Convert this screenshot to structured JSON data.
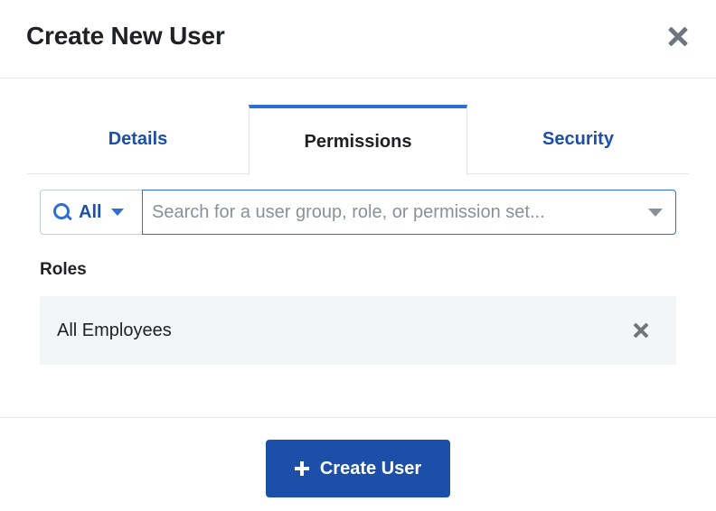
{
  "dialog": {
    "title": "Create New User"
  },
  "tabs": [
    {
      "label": "Details",
      "active": false
    },
    {
      "label": "Permissions",
      "active": true
    },
    {
      "label": "Security",
      "active": false
    }
  ],
  "search": {
    "filter_label": "All",
    "placeholder": "Search for a user group, role, or permission set...",
    "value": ""
  },
  "roles": {
    "heading": "Roles",
    "items": [
      {
        "name": "All Employees"
      }
    ]
  },
  "footer": {
    "create_label": "Create User"
  },
  "icons": {
    "close": "close-icon",
    "search": "search-icon",
    "filter_caret": "chevron-down-icon",
    "search_caret": "chevron-down-icon",
    "remove": "remove-icon",
    "plus": "plus-icon"
  },
  "colors": {
    "accent": "#2d6fd6",
    "primary_button": "#1c4fa8",
    "tab_link": "#1c4fa8",
    "row_background": "#f4f5f6"
  }
}
